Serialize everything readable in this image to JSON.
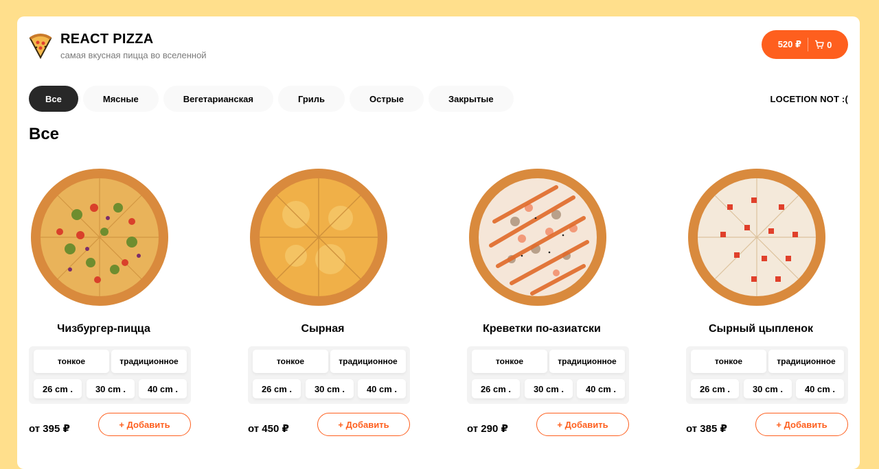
{
  "header": {
    "title": "REACT PIZZA",
    "subtitle": "самая вкусная пицца во вселенной",
    "cart_price": "520 ₽",
    "cart_count": "0"
  },
  "categories": [
    "Все",
    "Мясные",
    "Вегетарианская",
    "Гриль",
    "Острые",
    "Закрытые"
  ],
  "sort_label": "LOCETION NOT :(",
  "section_title": "Все",
  "pizzas": [
    {
      "name": "Чизбургер-пицца",
      "types": [
        "тонкое",
        "традиционное"
      ],
      "sizes": [
        "26 cm .",
        "30 cm .",
        "40 cm ."
      ],
      "price": "от 395 ₽",
      "add_label": "+ Добавить"
    },
    {
      "name": "Сырная",
      "types": [
        "тонкое",
        "традиционное"
      ],
      "sizes": [
        "26 cm .",
        "30 cm .",
        "40 cm ."
      ],
      "price": "от 450 ₽",
      "add_label": "+ Добавить"
    },
    {
      "name": "Креветки по-азиатски",
      "types": [
        "тонкое",
        "традиционное"
      ],
      "sizes": [
        "26 cm .",
        "30 cm .",
        "40 cm ."
      ],
      "price": "от 290 ₽",
      "add_label": "+ Добавить"
    },
    {
      "name": "Сырный цыпленок",
      "types": [
        "тонкое",
        "традиционное"
      ],
      "sizes": [
        "26 cm .",
        "30 cm .",
        "40 cm ."
      ],
      "price": "от 385 ₽",
      "add_label": "+ Добавить"
    }
  ],
  "colors": {
    "accent": "#fe5f1e",
    "background": "#ffdf8c"
  }
}
